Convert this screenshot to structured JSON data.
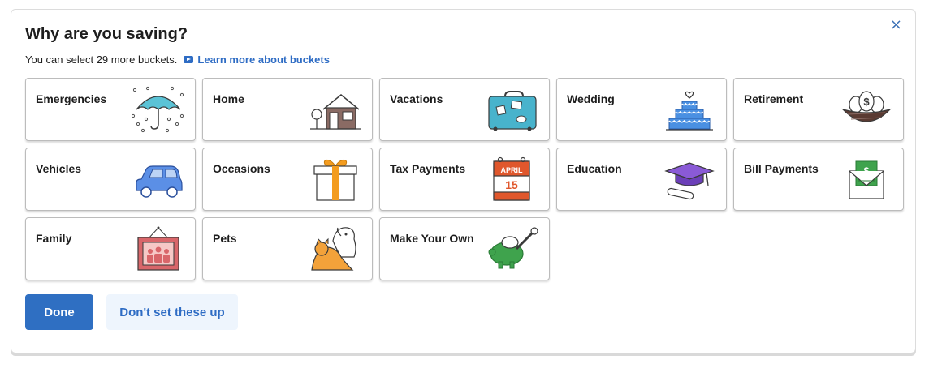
{
  "dialog": {
    "title": "Why are you saving?",
    "subtitle": "You can select 29 more buckets.",
    "learn_more": "Learn more about buckets",
    "close_label": "×"
  },
  "buckets": [
    {
      "label": "Emergencies",
      "icon": "umbrella-icon"
    },
    {
      "label": "Home",
      "icon": "house-icon"
    },
    {
      "label": "Vacations",
      "icon": "suitcase-icon"
    },
    {
      "label": "Wedding",
      "icon": "wedding-cake-icon"
    },
    {
      "label": "Retirement",
      "icon": "nest-egg-icon"
    },
    {
      "label": "Vehicles",
      "icon": "car-icon"
    },
    {
      "label": "Occasions",
      "icon": "gift-icon"
    },
    {
      "label": "Tax Payments",
      "icon": "calendar-icon",
      "calendar_month": "APRIL",
      "calendar_day": "15"
    },
    {
      "label": "Education",
      "icon": "graduation-cap-icon"
    },
    {
      "label": "Bill Payments",
      "icon": "envelope-dollar-icon"
    },
    {
      "label": "Family",
      "icon": "family-portrait-icon"
    },
    {
      "label": "Pets",
      "icon": "pets-icon"
    },
    {
      "label": "Make Your Own",
      "icon": "piggy-bank-icon"
    }
  ],
  "actions": {
    "done": "Done",
    "skip": "Don't set these up"
  },
  "colors": {
    "primary": "#2f6fc2",
    "link": "#2e6cc4",
    "secondary_bg": "#eef5fd"
  }
}
